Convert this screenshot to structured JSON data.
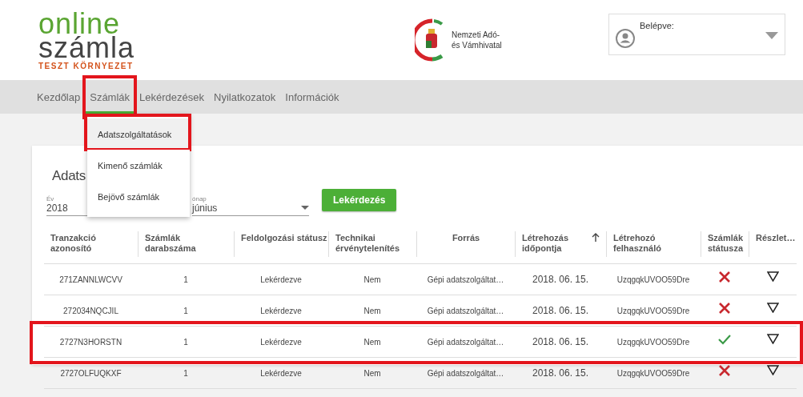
{
  "logo": {
    "line1": "online",
    "line2": "számla",
    "subtitle": "TESZT KÖRNYEZET"
  },
  "agency": {
    "line1": "Nemzeti Adó-",
    "line2": "és Vámhivatal"
  },
  "login": {
    "label": "Belépve:"
  },
  "tabs": [
    {
      "label": "Kezdőlap",
      "selected": false,
      "highlighted": false
    },
    {
      "label": "Számlák",
      "selected": true,
      "highlighted": true
    },
    {
      "label": "Lekérdezések",
      "selected": false,
      "highlighted": false
    },
    {
      "label": "Nyilatkozatok",
      "selected": false,
      "highlighted": false
    },
    {
      "label": "Információk",
      "selected": false,
      "highlighted": false
    }
  ],
  "menu": {
    "items": [
      {
        "label": "Adatszolgáltatások",
        "selected": true,
        "highlighted": true
      },
      {
        "label": "Kimenő számlák",
        "selected": false,
        "highlighted": false
      },
      {
        "label": "Bejövő számlák",
        "selected": false,
        "highlighted": false
      }
    ]
  },
  "card": {
    "title": "Adats",
    "filters": [
      {
        "label": "Év",
        "value": "2018",
        "kind": "text"
      },
      {
        "label": "ónap",
        "value": "június",
        "kind": "select"
      }
    ],
    "button": "Lekérdezés"
  },
  "table": {
    "columns": [
      {
        "label": "Tranzakció azonosító",
        "sorted": false
      },
      {
        "label": "Számlák darabszáma",
        "sorted": false
      },
      {
        "label": "Feldolgozási státusz",
        "sorted": false
      },
      {
        "label": "Technikai érvénytelenítés",
        "sorted": false
      },
      {
        "label": "Forrás",
        "sorted": false
      },
      {
        "label": "Létrehozás időpontja",
        "sorted": true
      },
      {
        "label": "Létrehozó felhasználó",
        "sorted": false
      },
      {
        "label": "Számlák státusza",
        "sorted": false
      },
      {
        "label": "Részlet…",
        "sorted": false
      }
    ],
    "rows": [
      {
        "cells": [
          "271ZANNLWCVV",
          "1",
          "Lekérdezve",
          "Nem",
          "Gépi adatszolgáltat…",
          "2018. 06. 15.",
          "UzqgqkUVOO59Dre"
        ],
        "valid": false,
        "highlighted": false
      },
      {
        "cells": [
          "272034NQCJIL",
          "1",
          "Lekérdezve",
          "Nem",
          "Gépi adatszolgáltat…",
          "2018. 06. 15.",
          "UzqgqkUVOO59Dre"
        ],
        "valid": false,
        "highlighted": false
      },
      {
        "cells": [
          "2727N3HORSTN",
          "1",
          "Lekérdezve",
          "Nem",
          "Gépi adatszolgáltat…",
          "2018. 06. 15.",
          "UzqgqkUVOO59Dre"
        ],
        "valid": true,
        "highlighted": true
      },
      {
        "cells": [
          "2727OLFUQKXF",
          "1",
          "Lekérdezve",
          "Nem",
          "Gépi adatszolgáltat…",
          "2018. 06. 15.",
          "UzqgqkUVOO59Dre"
        ],
        "valid": false,
        "highlighted": false
      }
    ]
  }
}
